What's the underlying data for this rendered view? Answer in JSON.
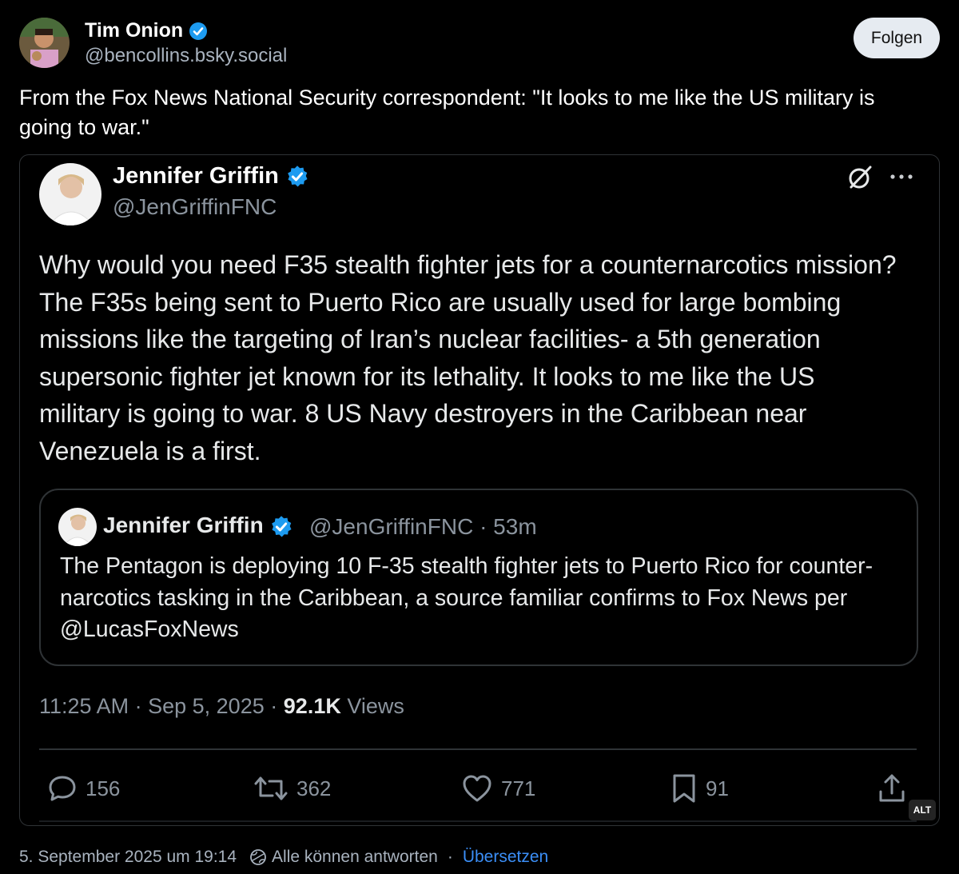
{
  "post": {
    "author_name": "Tim Onion",
    "author_handle": "@bencollins.bsky.social",
    "follow_label": "Folgen",
    "text": "From the Fox News National Security correspondent: \"It looks to me like the US military is going to war.\"",
    "timestamp": "5. September 2025 um 19:14",
    "reply_setting": "Alle können antworten",
    "separator": "·",
    "translate_label": "Übersetzen"
  },
  "embed": {
    "alt_badge": "ALT",
    "tweet": {
      "author_name": "Jennifer Griffin",
      "author_handle": "@JenGriffinFNC",
      "text": "Why would you need F35 stealth fighter jets for a counternarcotics mission? The F35s being sent to Puerto Rico are usually used for large bombing missions like the targeting of Iran’s nuclear facilities- a 5th generation supersonic fighter jet known for its lethality. It looks to me like the US military is going to war. 8 US Navy destroyers in the Caribbean near Venezuela is a first.",
      "time": "11:25 AM",
      "date": "Sep 5, 2025",
      "views_count": "92.1K",
      "views_label": "Views",
      "meta_separator": "·",
      "replies": "156",
      "reposts": "362",
      "likes": "771",
      "bookmarks": "91"
    },
    "quote": {
      "author_name": "Jennifer Griffin",
      "author_handle": "@JenGriffinFNC",
      "age": "· 53m",
      "text": "The Pentagon is deploying 10 F-35 stealth fighter jets to Puerto Rico for counter-narcotics tasking in the Caribbean, a source familiar confirms to Fox News per @LucasFoxNews"
    }
  },
  "colors": {
    "background": "#000000",
    "verified": "#1d9bf0",
    "link": "#3b8ef6",
    "muted": "#8b949e"
  },
  "icons": [
    "verified-badge-icon",
    "grok-icon",
    "more-icon",
    "reply-icon",
    "repost-icon",
    "like-icon",
    "bookmark-icon",
    "share-icon",
    "reply-settings-icon"
  ]
}
